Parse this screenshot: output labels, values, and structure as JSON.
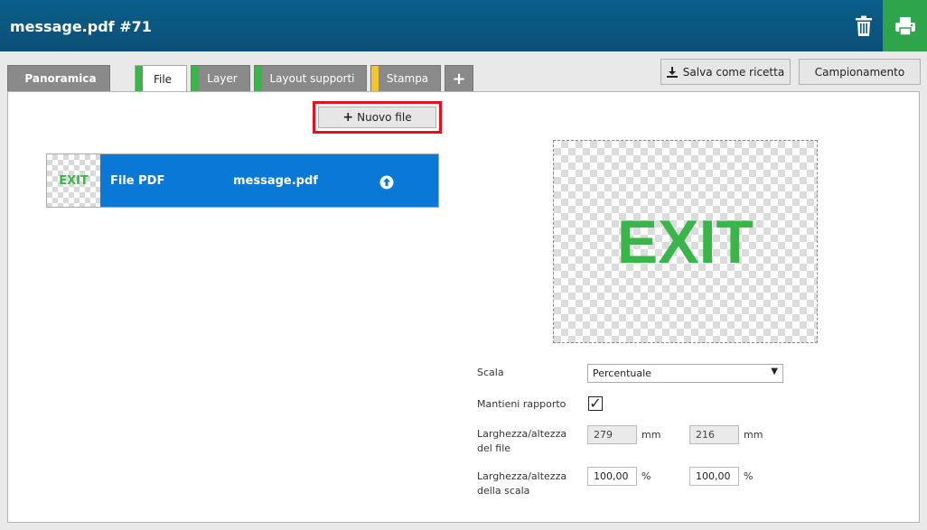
{
  "header": {
    "title": "message.pdf #71",
    "trash_icon": "trash-icon",
    "print_icon": "printer-icon",
    "accent": "#2ea54a"
  },
  "tabs": [
    {
      "label": "Panoramica",
      "stripe": null,
      "active": false
    },
    {
      "label": "File",
      "stripe": "#39b54a",
      "active": true
    },
    {
      "label": "Layer",
      "stripe": "#39b54a",
      "active": false
    },
    {
      "label": "Layout supporti",
      "stripe": "#39b54a",
      "active": false
    },
    {
      "label": "Stampa",
      "stripe": "#f4c430",
      "active": false
    },
    {
      "label": "+",
      "stripe": null,
      "active": false
    }
  ],
  "actions": {
    "save_recipe": "Salva come ricetta",
    "sampling": "Campionamento"
  },
  "new_file": {
    "label": "Nuovo file",
    "highlight": "#e0121b"
  },
  "file_item": {
    "thumb_text": "EXIT",
    "type": "File PDF",
    "name": "message.pdf",
    "bg": "#0a78d6"
  },
  "preview": {
    "text": "EXIT",
    "color": "#39b54a"
  },
  "settings": {
    "scale_label": "Scala",
    "scale_value": "Percentuale",
    "keep_ratio_label": "Mantieni rapporto",
    "keep_ratio_checked": "✓",
    "file_size_label_1": "Larghezza/altezza",
    "file_size_label_2": "del file",
    "file_width": "279",
    "file_height": "216",
    "unit_mm": "mm",
    "scale_size_label_1": "Larghezza/altezza",
    "scale_size_label_2": "della scala",
    "scale_width": "100,00",
    "scale_height": "100,00",
    "unit_pct": "%"
  }
}
